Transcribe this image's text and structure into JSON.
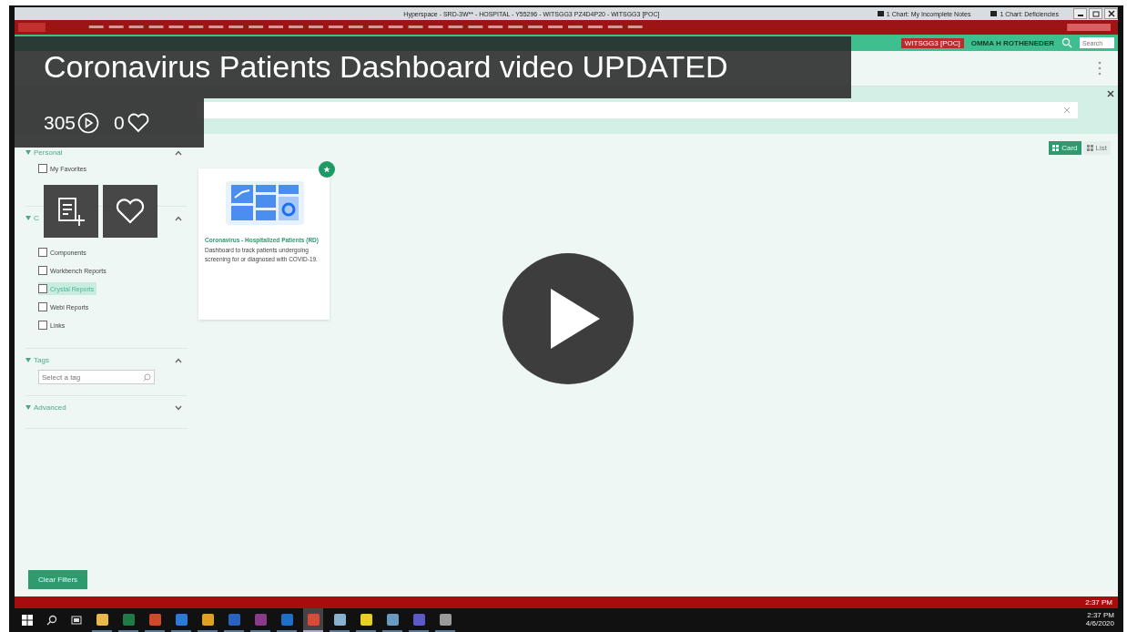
{
  "video": {
    "title": "Coronavirus Patients Dashboard video UPDATED",
    "views": "305",
    "likes": "0"
  },
  "screen": {
    "window_title": "Hyperspace - SRD-3W** - HOSPITAL - Y55296 - WITSGG3 PZ4D4P20 - WITSGG3 [POC]",
    "title_items": [
      {
        "count": "1",
        "label": "Chart: My Incomplete Notes"
      },
      {
        "count": "1",
        "label": "Chart: Deficiencies"
      }
    ],
    "header": {
      "environment": "WITSGG3 [POC]",
      "user": "OMMA H ROTHENEDER",
      "search_placeholder": "Search"
    },
    "view_toggle": [
      {
        "label": "Card",
        "selected": true
      },
      {
        "label": "List",
        "selected": false
      }
    ],
    "filters": [
      {
        "title": "Personal",
        "expanded": true,
        "options": [
          {
            "label": "My Favorites",
            "checked": false,
            "selected": false
          }
        ]
      },
      {
        "title": "C",
        "expanded": true,
        "options": [
          {
            "label": "Components",
            "checked": false,
            "selected": false
          },
          {
            "label": "Workbench Reports",
            "checked": false,
            "selected": false
          },
          {
            "label": "Crystal Reports",
            "checked": false,
            "selected": true
          },
          {
            "label": "Webi Reports",
            "checked": false,
            "selected": false
          },
          {
            "label": "Links",
            "checked": false,
            "selected": false
          }
        ]
      },
      {
        "title": "Tags",
        "expanded": true,
        "placeholder": "Select a tag"
      },
      {
        "title": "Advanced",
        "expanded": false
      }
    ],
    "cards": [
      {
        "title": "Coronavirus - Hospitalized Patients (RD)",
        "description": "Dashboard to track patients undergoing screening for or diagnosed with COVID-19.",
        "favorite": true
      }
    ],
    "clear_button": "Clear Filters",
    "status_time": "2:37 PM",
    "taskbar": {
      "icons": [
        {
          "kind": "start"
        },
        {
          "kind": "search"
        },
        {
          "kind": "taskview"
        },
        {
          "kind": "app",
          "color": "#e8b84a",
          "selected": false
        },
        {
          "kind": "app",
          "color": "#1f7a45",
          "selected": false
        },
        {
          "kind": "app",
          "color": "#d04a2a",
          "selected": false
        },
        {
          "kind": "app",
          "color": "#2a7bd4",
          "selected": false
        },
        {
          "kind": "app",
          "color": "#e0a020",
          "selected": false
        },
        {
          "kind": "app",
          "color": "#2a62c0",
          "selected": false
        },
        {
          "kind": "app",
          "color": "#8a3a8a",
          "selected": false
        },
        {
          "kind": "app",
          "color": "#1e6fc8",
          "selected": false
        },
        {
          "kind": "app",
          "color": "#d84a3a",
          "selected": true
        },
        {
          "kind": "app",
          "color": "#8ab0d0",
          "selected": false
        },
        {
          "kind": "app",
          "color": "#e8d020",
          "selected": false
        },
        {
          "kind": "app",
          "color": "#6a9ac0",
          "selected": false
        },
        {
          "kind": "app",
          "color": "#5a5ac8",
          "selected": false
        },
        {
          "kind": "app",
          "color": "#9a9a9a",
          "selected": false
        }
      ],
      "time": "2:37 PM",
      "date": "4/6/2020"
    }
  }
}
